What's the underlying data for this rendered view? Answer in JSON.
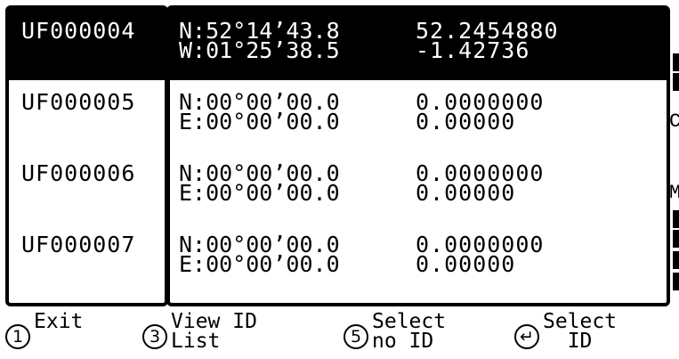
{
  "rows": [
    {
      "id": "UF000004",
      "lat_dms": "N:52°14’43.8",
      "lon_dms": "W:01°25’38.5",
      "lat_dec": "52.2454880",
      "lon_dec": "-1.42736",
      "selected": true
    },
    {
      "id": "UF000005",
      "lat_dms": "N:00°00’00.0",
      "lon_dms": "E:00°00’00.0",
      "lat_dec": "0.0000000",
      "lon_dec": "0.00000",
      "selected": false
    },
    {
      "id": "UF000006",
      "lat_dms": "N:00°00’00.0",
      "lon_dms": "E:00°00’00.0",
      "lat_dec": "0.0000000",
      "lon_dec": "0.00000",
      "selected": false
    },
    {
      "id": "UF000007",
      "lat_dms": "N:00°00’00.0",
      "lon_dms": "E:00°00’00.0",
      "lat_dec": "0.0000000",
      "lon_dec": "0.00000",
      "selected": false
    }
  ],
  "edge_letters": [
    "C",
    "M"
  ],
  "softkeys": [
    {
      "key": "1",
      "label": "Exit",
      "icon": "key-1-icon"
    },
    {
      "key": "3",
      "label": "View ID\nList",
      "icon": "key-3-icon"
    },
    {
      "key": "5",
      "label": "Select\nno ID",
      "icon": "key-5-icon"
    },
    {
      "key": "↵",
      "label": "Select\n  ID",
      "icon": "enter-key-icon"
    }
  ]
}
